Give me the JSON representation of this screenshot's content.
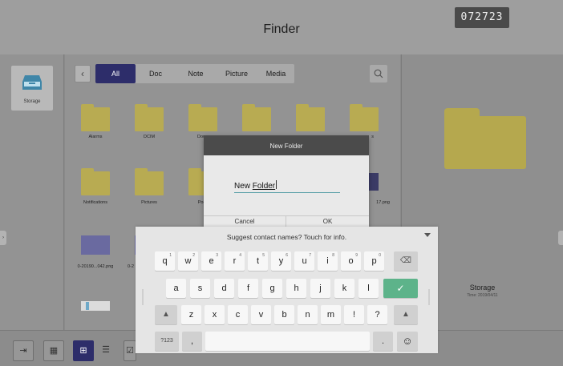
{
  "header": {
    "title": "Finder",
    "code_badge": "072723"
  },
  "sidebar": {
    "storage_label": "Storage"
  },
  "toolbar": {
    "tabs": [
      {
        "label": "All",
        "active": true
      },
      {
        "label": "Doc",
        "active": false
      },
      {
        "label": "Note",
        "active": false
      },
      {
        "label": "Picture",
        "active": false
      },
      {
        "label": "Media",
        "active": false
      }
    ]
  },
  "files": {
    "row1": [
      "Alarms",
      "DCIM",
      "Down",
      "",
      "",
      "s"
    ],
    "row2": [
      "Notifications",
      "Pictures",
      "Podc",
      "",
      "",
      "17.png"
    ],
    "row3": [
      "0-20190...042.png",
      "0-2"
    ]
  },
  "preview": {
    "name": "Storage",
    "time": "Time: 2019/04/11"
  },
  "dialog": {
    "title": "New Folder",
    "input_plain": "New ",
    "input_underlined": "Folder",
    "cancel_label": "Cancel",
    "ok_label": "OK"
  },
  "keyboard": {
    "suggestion": "Suggest contact names? Touch for info.",
    "row1": [
      {
        "key": "q",
        "sup": "1"
      },
      {
        "key": "w",
        "sup": "2"
      },
      {
        "key": "e",
        "sup": "3"
      },
      {
        "key": "r",
        "sup": "4"
      },
      {
        "key": "t",
        "sup": "5"
      },
      {
        "key": "y",
        "sup": "6"
      },
      {
        "key": "u",
        "sup": "7"
      },
      {
        "key": "i",
        "sup": "8"
      },
      {
        "key": "o",
        "sup": "9"
      },
      {
        "key": "p",
        "sup": "0"
      }
    ],
    "row2": [
      "a",
      "s",
      "d",
      "f",
      "g",
      "h",
      "j",
      "k",
      "l"
    ],
    "row3": [
      "z",
      "x",
      "c",
      "v",
      "b",
      "n",
      "m",
      "!",
      "?"
    ],
    "symbols_label": "?123",
    "comma": ",",
    "period": ".",
    "enter_glyph": "✓",
    "backspace_glyph": "⌫",
    "shift_glyph": "▲",
    "emoji_glyph": "☺"
  },
  "colors": {
    "accent": "#2d2d6a",
    "folder": "#b8ab52",
    "enter_key": "#5db38a",
    "input_underline": "#5aa0a8"
  },
  "icons": {
    "storage": "storage-tray-icon",
    "back": "chevron-left-icon",
    "search": "search-icon",
    "collapse": "chevron-down-icon"
  }
}
